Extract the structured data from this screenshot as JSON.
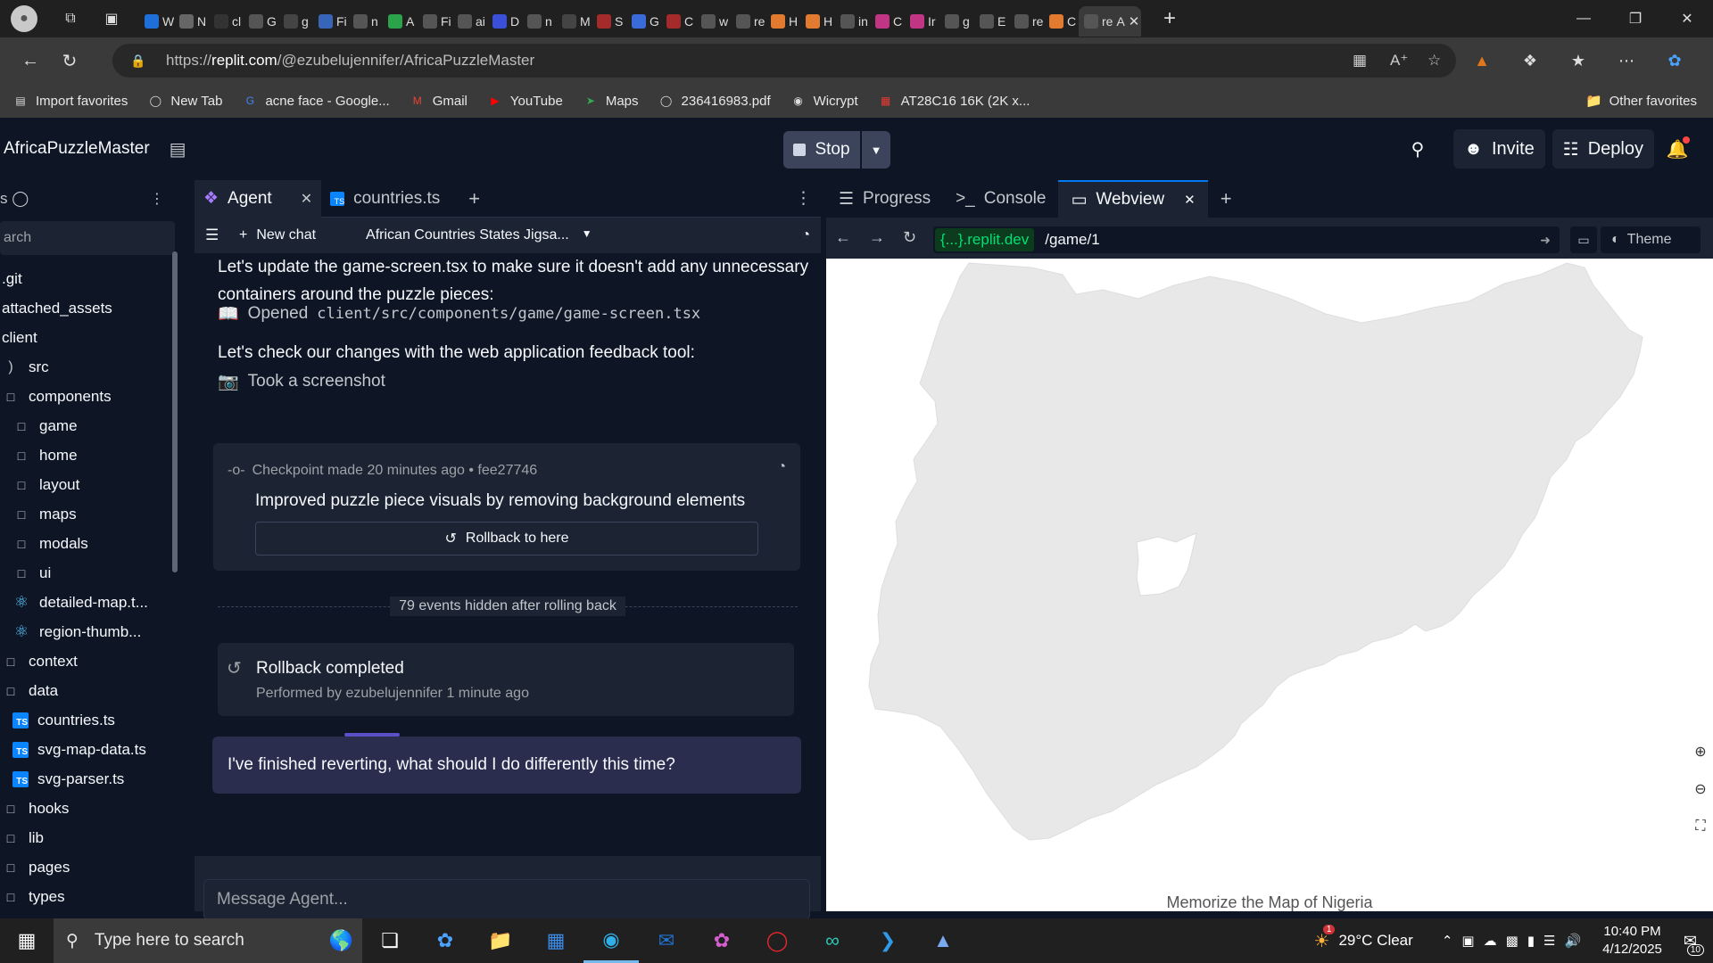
{
  "browser": {
    "tabs": [
      {
        "letter": "W",
        "color": "#1e6fd9"
      },
      {
        "letter": "N",
        "color": "#666"
      },
      {
        "letter": "cl",
        "color": "#333"
      },
      {
        "letter": "G",
        "color": "#555"
      },
      {
        "letter": "g",
        "color": "#444"
      },
      {
        "letter": "Fi",
        "color": "#3766b8"
      },
      {
        "letter": "n",
        "color": "#555"
      },
      {
        "letter": "A",
        "color": "#2aa34a"
      },
      {
        "letter": "Fi",
        "color": "#555"
      },
      {
        "letter": "ai",
        "color": "#555"
      },
      {
        "letter": "D",
        "color": "#3b50d8"
      },
      {
        "letter": "n",
        "color": "#555"
      },
      {
        "letter": "M",
        "color": "#444"
      },
      {
        "letter": "S",
        "color": "#a52a2a"
      },
      {
        "letter": "G",
        "color": "#3b6bd8"
      },
      {
        "letter": "C",
        "color": "#a52a2a"
      },
      {
        "letter": "w",
        "color": "#555"
      },
      {
        "letter": "re",
        "color": "#555"
      },
      {
        "letter": "H",
        "color": "#e27b2f"
      },
      {
        "letter": "H",
        "color": "#e27b2f"
      },
      {
        "letter": "in",
        "color": "#555"
      },
      {
        "letter": "C",
        "color": "#c13584"
      },
      {
        "letter": "Ir",
        "color": "#c13584"
      },
      {
        "letter": "g",
        "color": "#555"
      },
      {
        "letter": "E",
        "color": "#555"
      },
      {
        "letter": "re",
        "color": "#555"
      },
      {
        "letter": "C",
        "color": "#e27b2f"
      }
    ],
    "active_tab": {
      "letter": "re",
      "extra": "A"
    },
    "url_prefix": "https://",
    "url_host": "replit.com",
    "url_path": "/@ezubelujennifer/AfricaPuzzleMaster",
    "bookmarks": [
      {
        "label": "Import favorites",
        "icon": "import-icon"
      },
      {
        "label": "New Tab",
        "icon": "globe-icon"
      },
      {
        "label": "acne face - Google...",
        "icon": "google-icon"
      },
      {
        "label": "Gmail",
        "icon": "gmail-icon"
      },
      {
        "label": "YouTube",
        "icon": "youtube-icon"
      },
      {
        "label": "Maps",
        "icon": "maps-icon"
      },
      {
        "label": "236416983.pdf",
        "icon": "globe-icon"
      },
      {
        "label": "Wicrypt",
        "icon": "wicrypt-icon"
      },
      {
        "label": "AT28C16 16K (2K x...",
        "icon": "grid-icon"
      }
    ],
    "other_favorites": "Other favorites"
  },
  "app": {
    "project_name": "AfricaPuzzleMaster",
    "stop_label": "Stop",
    "invite_label": "Invite",
    "deploy_label": "Deploy"
  },
  "filetree": {
    "search_placeholder": "arch",
    "items": [
      {
        "label": ".git",
        "kind": "folder-plain",
        "indent": 0
      },
      {
        "label": "attached_assets",
        "kind": "folder-plain",
        "indent": 0
      },
      {
        "label": "client",
        "kind": "folder-plain",
        "indent": 0
      },
      {
        "label": "src",
        "kind": "folder-open",
        "indent": 0
      },
      {
        "label": "components",
        "kind": "folder",
        "indent": 0
      },
      {
        "label": "game",
        "kind": "folder",
        "indent": 1
      },
      {
        "label": "home",
        "kind": "folder",
        "indent": 1
      },
      {
        "label": "layout",
        "kind": "folder",
        "indent": 1
      },
      {
        "label": "maps",
        "kind": "folder",
        "indent": 1
      },
      {
        "label": "modals",
        "kind": "folder",
        "indent": 1
      },
      {
        "label": "ui",
        "kind": "folder",
        "indent": 1
      },
      {
        "label": "detailed-map.t...",
        "kind": "react",
        "indent": 1
      },
      {
        "label": "region-thumb...",
        "kind": "react",
        "indent": 1
      },
      {
        "label": "context",
        "kind": "folder",
        "indent": 0
      },
      {
        "label": "data",
        "kind": "folder",
        "indent": 0
      },
      {
        "label": "countries.ts",
        "kind": "ts",
        "indent": 1
      },
      {
        "label": "svg-map-data.ts",
        "kind": "ts",
        "indent": 1
      },
      {
        "label": "svg-parser.ts",
        "kind": "ts",
        "indent": 1
      },
      {
        "label": "hooks",
        "kind": "folder",
        "indent": 0
      },
      {
        "label": "lib",
        "kind": "folder",
        "indent": 0
      },
      {
        "label": "pages",
        "kind": "folder",
        "indent": 0
      },
      {
        "label": "types",
        "kind": "folder",
        "indent": 0
      }
    ]
  },
  "agent": {
    "tabs": [
      {
        "label": "Agent"
      },
      {
        "label": "countries.ts"
      }
    ],
    "new_chat": "New chat",
    "chat_title": "African Countries States Jigsa...",
    "msg1": "Let's update the game-screen.tsx to make sure it doesn't add any unnecessary containers around the puzzle pieces:",
    "opened_label": "Opened",
    "opened_path": "client/src/components/game/game-screen.tsx",
    "msg2": "Let's check our changes with the web application feedback tool:",
    "screenshot_label": "Took a screenshot",
    "checkpoint_meta": "Checkpoint made 20 minutes ago • fee27746",
    "checkpoint_title": "Improved puzzle piece visuals by removing background elements",
    "rollback_label": "Rollback to here",
    "hidden_events": "79 events hidden after rolling back",
    "rollback_title": "Rollback completed",
    "rollback_sub": "Performed by ezubelujennifer 1 minute ago",
    "user_message": "I've finished reverting, what should I do differently this time?",
    "input_placeholder": "Message Agent..."
  },
  "webview": {
    "tabs": [
      {
        "label": "Progress"
      },
      {
        "label": "Console"
      },
      {
        "label": "Webview"
      }
    ],
    "domain": "{...}.replit.dev",
    "path": "/game/1",
    "theme_label": "Theme",
    "caption": "Memorize the Map of Nigeria",
    "map_fill": "#e8e8e8"
  },
  "taskbar": {
    "search_placeholder": "Type here to search",
    "weather": "29°C  Clear",
    "weather_badge": "1",
    "time": "10:40 PM",
    "date": "4/12/2025",
    "notif_count": "10"
  },
  "colors": {
    "bg": "#0e1525",
    "panel": "#1c2333",
    "accent": "#0079f2",
    "user_bubble": "#2a2d4e"
  }
}
